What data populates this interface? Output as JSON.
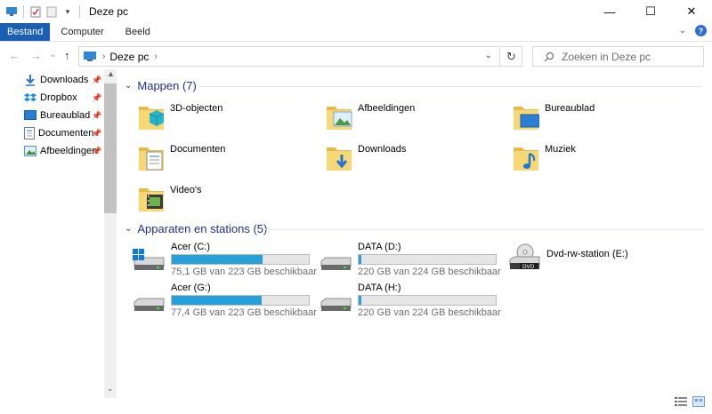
{
  "window": {
    "title": "Deze pc",
    "controls": {
      "minimize": "—",
      "maximize": "☐",
      "close": "✕"
    }
  },
  "ribbon": {
    "tabs": [
      "Bestand",
      "Computer",
      "Beeld"
    ],
    "help": "?"
  },
  "navigation": {
    "back": "←",
    "forward": "→",
    "recent": "⌄",
    "up": "↑",
    "address": {
      "crumb": "Deze pc",
      "separator": "›"
    },
    "refresh": "↻",
    "search_placeholder": "Zoeken in Deze pc"
  },
  "sidebar": {
    "items": [
      {
        "label": "Downloads",
        "icon": "downloads-icon",
        "pinned": true
      },
      {
        "label": "Dropbox",
        "icon": "dropbox-icon",
        "pinned": true
      },
      {
        "label": "Bureaublad",
        "icon": "desktop-icon",
        "pinned": true
      },
      {
        "label": "Documenten",
        "icon": "documents-icon",
        "pinned": true
      },
      {
        "label": "Afbeeldingen",
        "icon": "pictures-icon",
        "pinned": true
      }
    ]
  },
  "main": {
    "folders_header": "Mappen (7)",
    "folders": [
      {
        "label": "3D-objecten",
        "icon": "3d-objects-icon"
      },
      {
        "label": "Afbeeldingen",
        "icon": "pictures-icon"
      },
      {
        "label": "Bureaublad",
        "icon": "desktop-icon"
      },
      {
        "label": "Documenten",
        "icon": "documents-icon"
      },
      {
        "label": "Downloads",
        "icon": "downloads-icon"
      },
      {
        "label": "Muziek",
        "icon": "music-icon"
      },
      {
        "label": "Video's",
        "icon": "videos-icon"
      }
    ],
    "drives_header": "Apparaten en stations (5)",
    "drives": [
      {
        "label": "Acer (C:)",
        "free_text": "75,1 GB van 223 GB beschikbaar",
        "used_fraction": 0.663,
        "icon": "system-drive-icon"
      },
      {
        "label": "DATA (D:)",
        "free_text": "220 GB van 224 GB beschikbaar",
        "used_fraction": 0.018,
        "icon": "hard-drive-icon"
      },
      {
        "label": "Dvd-rw-station (E:)",
        "icon": "dvd-drive-icon"
      },
      {
        "label": "Acer (G:)",
        "free_text": "77,4 GB van 223 GB beschikbaar",
        "used_fraction": 0.653,
        "icon": "hard-drive-icon"
      },
      {
        "label": "DATA (H:)",
        "free_text": "220 GB van 224 GB beschikbaar",
        "used_fraction": 0.018,
        "icon": "hard-drive-icon"
      }
    ]
  },
  "colors": {
    "file_tab": "#1a5fb4",
    "section_header": "#1e3287",
    "drive_bar": "#26a0da",
    "folder_yellow": "#f8d775"
  }
}
